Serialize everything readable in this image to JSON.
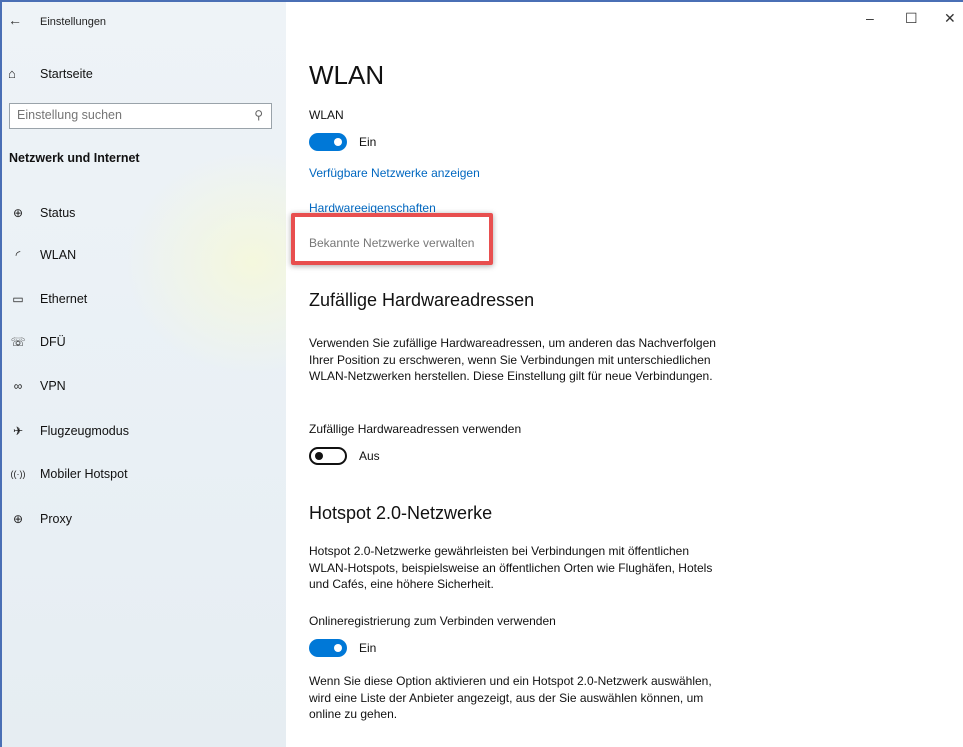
{
  "window": {
    "app_title": "Einstellungen",
    "back_icon": "←",
    "minimize_icon": "–",
    "maximize_icon": "☐",
    "close_icon": "✕"
  },
  "sidebar": {
    "home_label": "Startseite",
    "home_icon": "⌂",
    "search_placeholder": "Einstellung suchen",
    "search_icon": "⚲",
    "section_title": "Netzwerk und Internet",
    "items": [
      {
        "label": "Status",
        "icon": "⊕"
      },
      {
        "label": "WLAN",
        "icon": "◜"
      },
      {
        "label": "Ethernet",
        "icon": "▭"
      },
      {
        "label": "DFÜ",
        "icon": "☏"
      },
      {
        "label": "VPN",
        "icon": "∞"
      },
      {
        "label": "Flugzeugmodus",
        "icon": "✈"
      },
      {
        "label": "Mobiler Hotspot",
        "icon": "((·))"
      },
      {
        "label": "Proxy",
        "icon": "⊕"
      }
    ]
  },
  "main": {
    "title": "WLAN",
    "wlan_label": "WLAN",
    "wlan_state": "Ein",
    "link_networks": "Verfügbare Netzwerke anzeigen",
    "link_hardware": "Hardwareeigenschaften",
    "link_known": "Bekannte Netzwerke verwalten",
    "random_heading": "Zufällige Hardwareadressen",
    "random_desc": "Verwenden Sie zufällige Hardwareadressen, um anderen das Nachverfolgen Ihrer Position zu erschweren, wenn Sie Verbindungen mit unterschiedlichen WLAN-Netzwerken herstellen. Diese Einstellung gilt für neue Verbindungen.",
    "random_toggle_label": "Zufällige Hardwareadressen verwenden",
    "random_state": "Aus",
    "hotspot_heading": "Hotspot 2.0-Netzwerke",
    "hotspot_desc": "Hotspot 2.0-Netzwerke gewährleisten bei Verbindungen mit öffentlichen WLAN-Hotspots, beispielsweise an öffentlichen Orten wie Flughäfen, Hotels und Cafés, eine höhere Sicherheit.",
    "online_label": "Onlineregistrierung zum Verbinden verwenden",
    "online_state": "Ein",
    "online_desc": "Wenn Sie diese Option aktivieren und ein Hotspot 2.0-Netzwerk auswählen, wird eine Liste der Anbieter angezeigt, aus der Sie auswählen können, um online zu gehen."
  },
  "colors": {
    "accent": "#0078d7",
    "link": "#0067c0",
    "highlight": "#e84f4f"
  }
}
